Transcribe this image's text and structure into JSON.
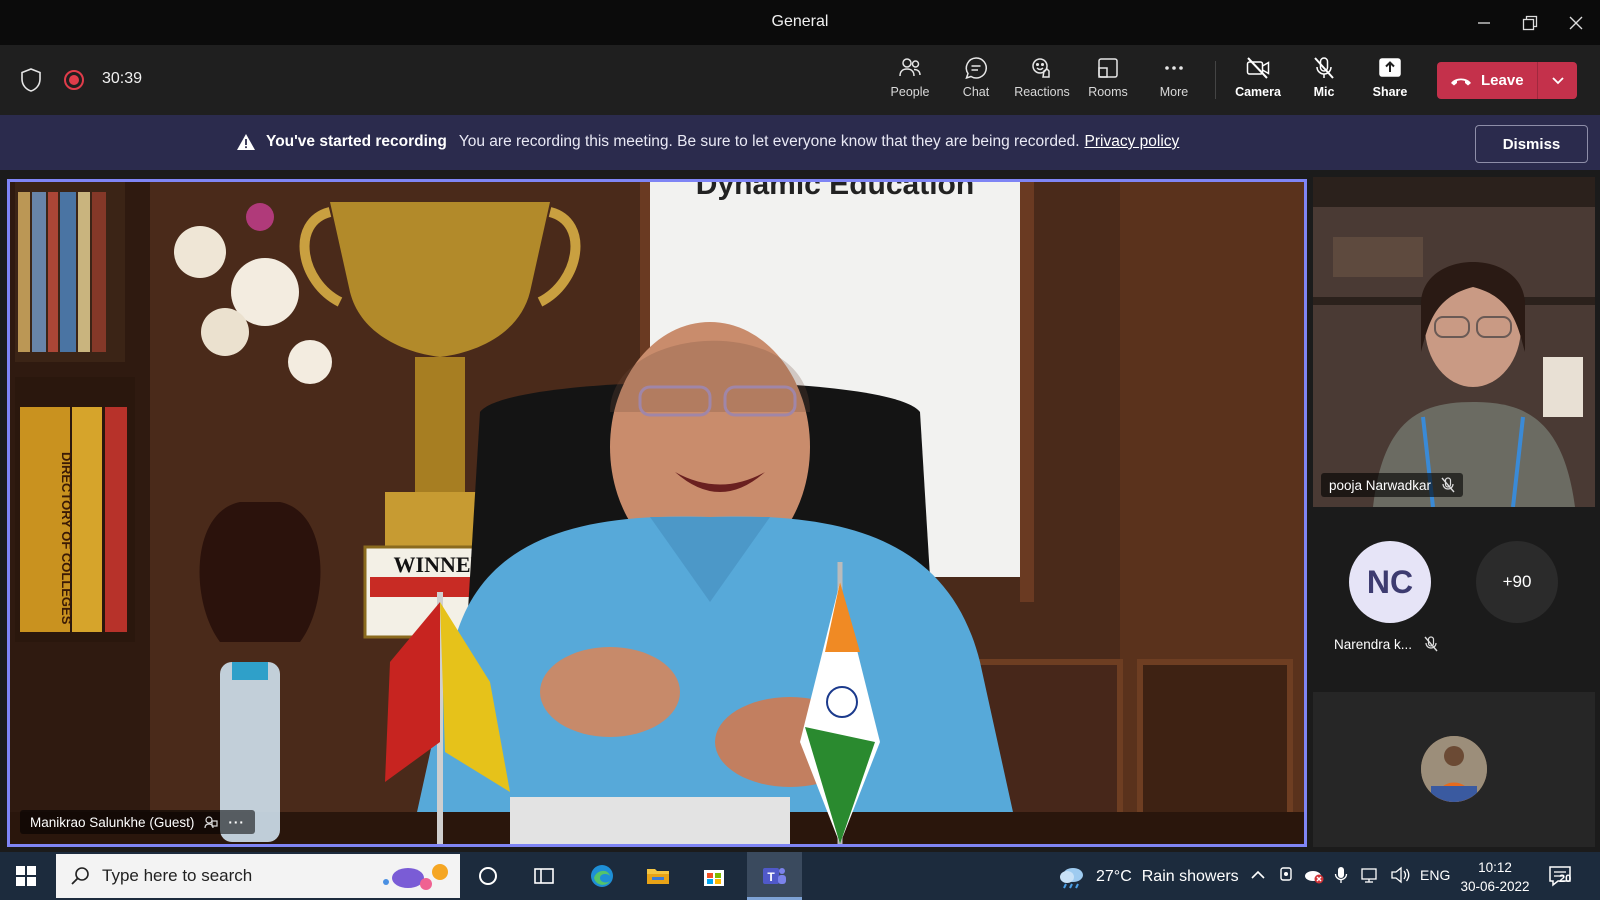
{
  "window": {
    "title": "General"
  },
  "toolbar": {
    "timer": "30:39",
    "buttons": {
      "people": "People",
      "chat": "Chat",
      "reactions": "Reactions",
      "rooms": "Rooms",
      "more": "More",
      "camera": "Camera",
      "mic": "Mic",
      "share": "Share"
    },
    "leave_label": "Leave",
    "leave_color": "#c4314b"
  },
  "banner": {
    "heading": "You've started recording",
    "message": "You are recording this meeting. Be sure to let everyone know that they are being recorded.",
    "link": "Privacy policy",
    "dismiss": "Dismiss",
    "background": "#2b2b4d"
  },
  "main_video": {
    "participant": "Manikrao Salunkhe (Guest)",
    "sign_text": "Dynamic Education",
    "trophy_text": "WINNER",
    "book_text": "DIRECTORY OF COLLEGES",
    "highlight_color": "#7f85f5"
  },
  "side_tiles": [
    {
      "name": "pooja Narwadkar",
      "muted": true
    },
    {
      "initials": "NC",
      "name": "Narendra k...",
      "muted": true
    },
    {
      "overflow": "+90"
    }
  ],
  "taskbar": {
    "search_placeholder": "Type here to search",
    "weather_temp": "27°C",
    "weather_text": "Rain showers",
    "language": "ENG",
    "time": "10:12",
    "date": "30-06-2022",
    "notifications": "20"
  }
}
